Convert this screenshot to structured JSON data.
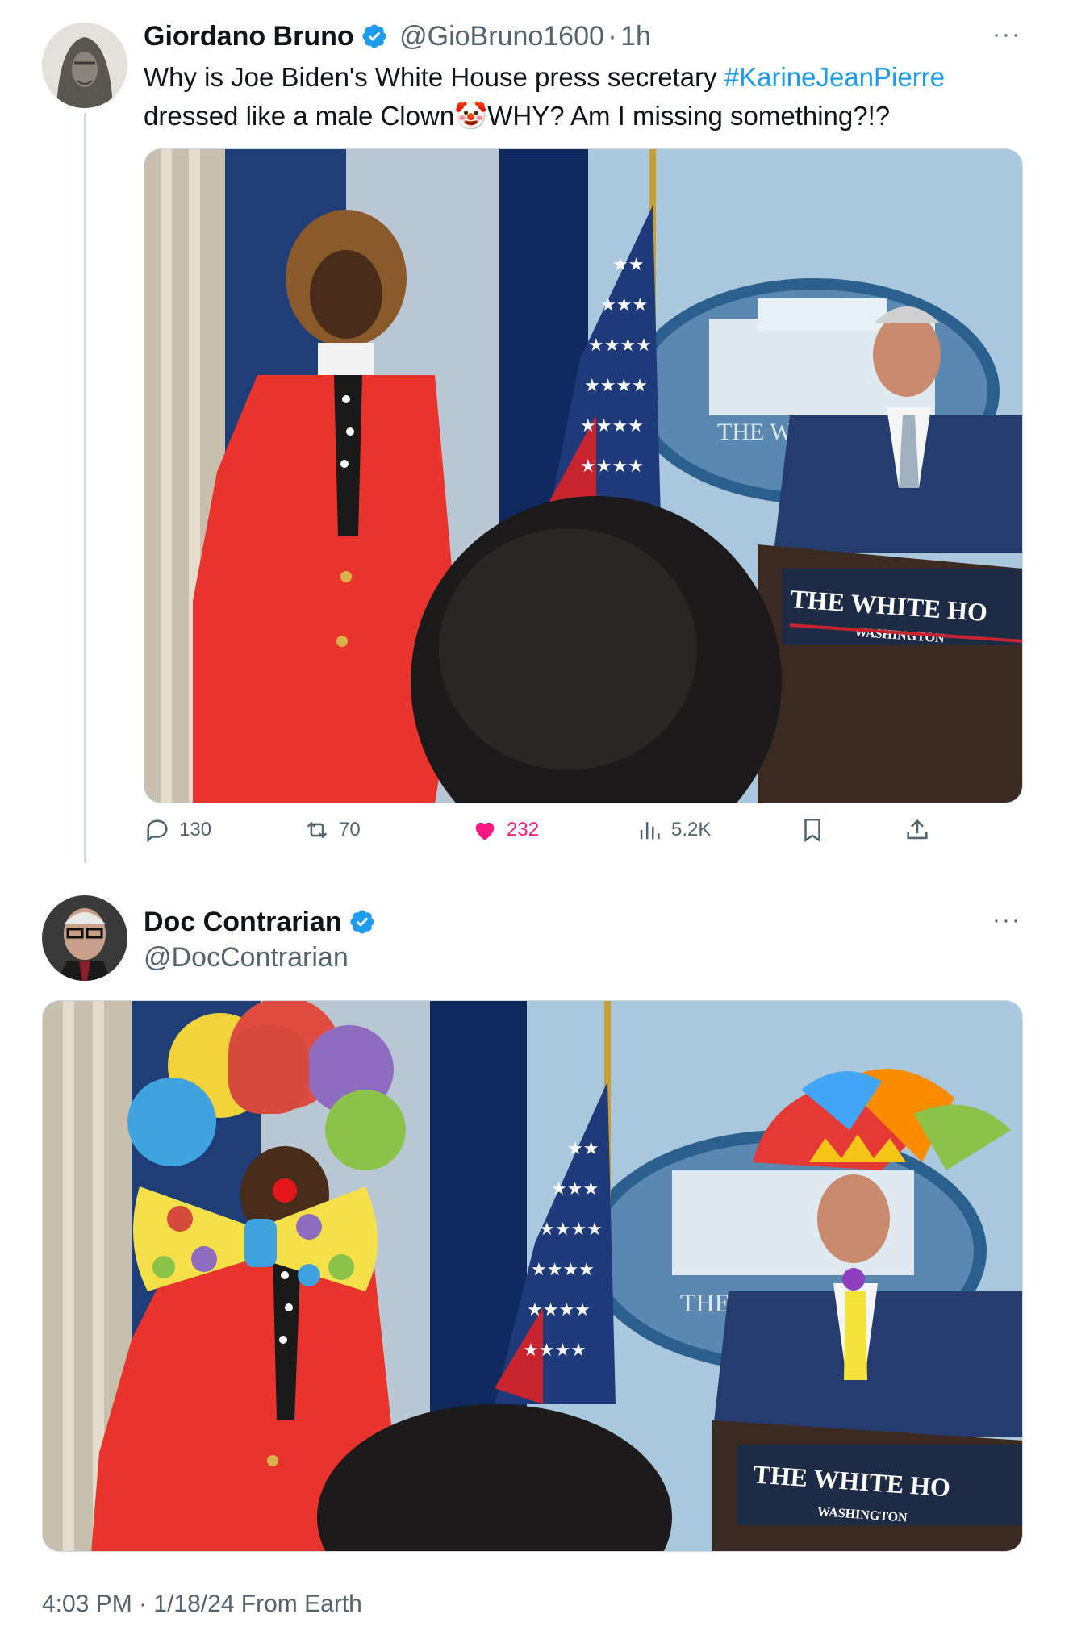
{
  "tweet1": {
    "author_name": "Giordano Bruno",
    "handle": "@GioBruno1600",
    "separator": "·",
    "time": "1h",
    "text_before": "Why is Joe Biden's White House press secretary ",
    "hashtag": "#KarineJeanPierre",
    "text_after": " dressed like a male Clown",
    "emoji": "🤡",
    "text_end": "WHY? Am I missing something?!?",
    "image_sign_main": "THE WHITE HO",
    "image_sign_sub": "WASHINGTON",
    "image_seal_text": "THE WH",
    "actions": {
      "replies": "130",
      "reposts": "70",
      "likes": "232",
      "views": "5.2K"
    }
  },
  "tweet2": {
    "author_name": "Doc Contrarian",
    "handle": "@DocContrarian",
    "image_sign_main": "THE WHITE HO",
    "image_sign_sub": "WASHINGTON",
    "image_seal_text": "THE W",
    "timestamp": "4:03 PM · 1/18/24 From Earth"
  },
  "more_label": "···",
  "colors": {
    "link": "#1d9bf0",
    "like": "#f91880",
    "muted": "#536471",
    "verified": "#1d9bf0"
  },
  "icons": [
    "verified-badge-icon",
    "reply-icon",
    "repost-icon",
    "heart-icon",
    "views-icon",
    "bookmark-icon",
    "share-icon",
    "more-icon"
  ]
}
